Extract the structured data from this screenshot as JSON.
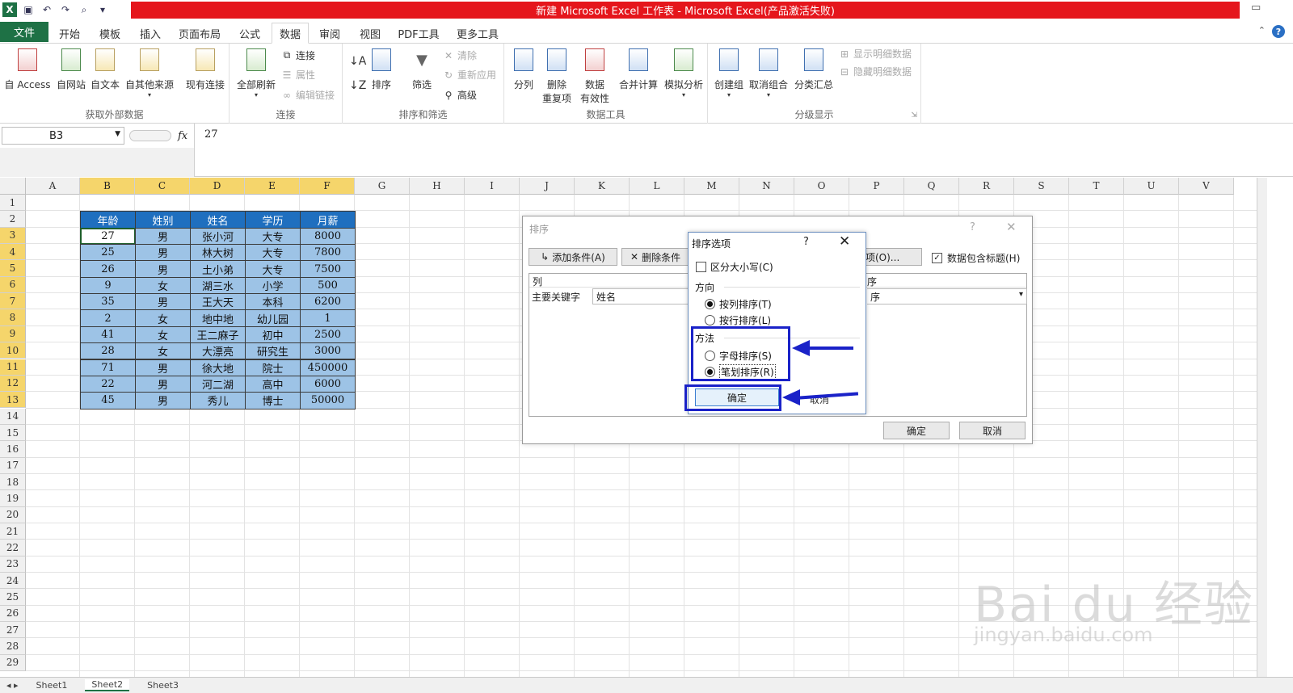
{
  "window": {
    "title": "新建 Microsoft Excel 工作表 - Microsoft Excel(产品激活失败)"
  },
  "menu": {
    "file": "文件",
    "tabs": [
      "开始",
      "模板",
      "插入",
      "页面布局",
      "公式",
      "数据",
      "审阅",
      "视图",
      "PDF工具",
      "更多工具"
    ],
    "active": "数据"
  },
  "ribbon": {
    "external": {
      "label": "获取外部数据",
      "buttons": [
        "自 Access",
        "自网站",
        "自文本",
        "自其他来源",
        "现有连接"
      ]
    },
    "connections": {
      "label": "连接",
      "refresh": "全部刷新",
      "items": [
        "连接",
        "属性",
        "编辑链接"
      ]
    },
    "sortfilter": {
      "label": "排序和筛选",
      "sort": "排序",
      "filter": "筛选",
      "items": [
        "清除",
        "重新应用",
        "高级"
      ]
    },
    "datatools": {
      "label": "数据工具",
      "buttons": [
        "分列",
        "删除\n重复项",
        "数据\n有效性",
        "合并计算",
        "模拟分析"
      ]
    },
    "outline": {
      "label": "分级显示",
      "buttons": [
        "创建组",
        "取消组合",
        "分类汇总"
      ],
      "items": [
        "显示明细数据",
        "隐藏明细数据"
      ]
    }
  },
  "formula_bar": {
    "name_box": "B3",
    "fx": "fx",
    "value": "27"
  },
  "sheet": {
    "columns": [
      "A",
      "B",
      "C",
      "D",
      "E",
      "F",
      "G",
      "H",
      "I",
      "J",
      "K",
      "L",
      "M",
      "N",
      "O",
      "P",
      "Q",
      "R",
      "S",
      "T",
      "U",
      "V"
    ],
    "rows": [
      "1",
      "2",
      "3",
      "4",
      "5",
      "6",
      "7",
      "8",
      "9",
      "10",
      "11",
      "12",
      "13",
      "14",
      "15",
      "16",
      "17",
      "18",
      "19",
      "20",
      "21",
      "22",
      "23",
      "24",
      "25",
      "26",
      "27",
      "28",
      "29"
    ],
    "headers": [
      "年龄",
      "姓别",
      "姓名",
      "学历",
      "月薪"
    ],
    "data": [
      [
        "27",
        "男",
        "张小河",
        "大专",
        "8000"
      ],
      [
        "25",
        "男",
        "林大树",
        "大专",
        "7800"
      ],
      [
        "26",
        "男",
        "土小弟",
        "大专",
        "7500"
      ],
      [
        "9",
        "女",
        "湖三水",
        "小学",
        "500"
      ],
      [
        "35",
        "男",
        "王大天",
        "本科",
        "6200"
      ],
      [
        "2",
        "女",
        "地中地",
        "幼儿园",
        "1"
      ],
      [
        "41",
        "女",
        "王二麻子",
        "初中",
        "2500"
      ],
      [
        "28",
        "女",
        "大漂亮",
        "研究生",
        "3000"
      ],
      [
        "71",
        "男",
        "徐大地",
        "院士",
        "450000"
      ],
      [
        "22",
        "男",
        "河二湖",
        "高中",
        "6000"
      ],
      [
        "45",
        "男",
        "秀儿",
        "博士",
        "50000"
      ]
    ]
  },
  "sort_dialog": {
    "title": "排序",
    "add_condition": "添加条件(A)",
    "delete_condition": "删除条件",
    "options_button": "项(O)...",
    "has_header": "数据包含标题(H)",
    "col_header": "列",
    "order_header": "序",
    "primary_key_label": "主要关键字",
    "primary_key_value": "姓名",
    "order_value": "序",
    "ok": "确定",
    "cancel": "取消"
  },
  "options_dialog": {
    "title": "排序选项",
    "case_sensitive": "区分大小写(C)",
    "direction_label": "方向",
    "by_column": "按列排序(T)",
    "by_row": "按行排序(L)",
    "method_label": "方法",
    "alphabetic": "字母排序(S)",
    "stroke": "笔划排序(R)",
    "ok": "确定",
    "cancel": "取消"
  },
  "sheet_tabs": [
    "Sheet1",
    "Sheet2",
    "Sheet3"
  ],
  "watermark": {
    "brand": "Bai du 经验",
    "url": "jingyan.baidu.com"
  },
  "colors": {
    "excel_green": "#1e7145",
    "title_red": "#e5161c",
    "header_blue": "#1f6fbf",
    "cell_blue": "#9dc3e6",
    "highlight_blue": "#1a22c8"
  }
}
